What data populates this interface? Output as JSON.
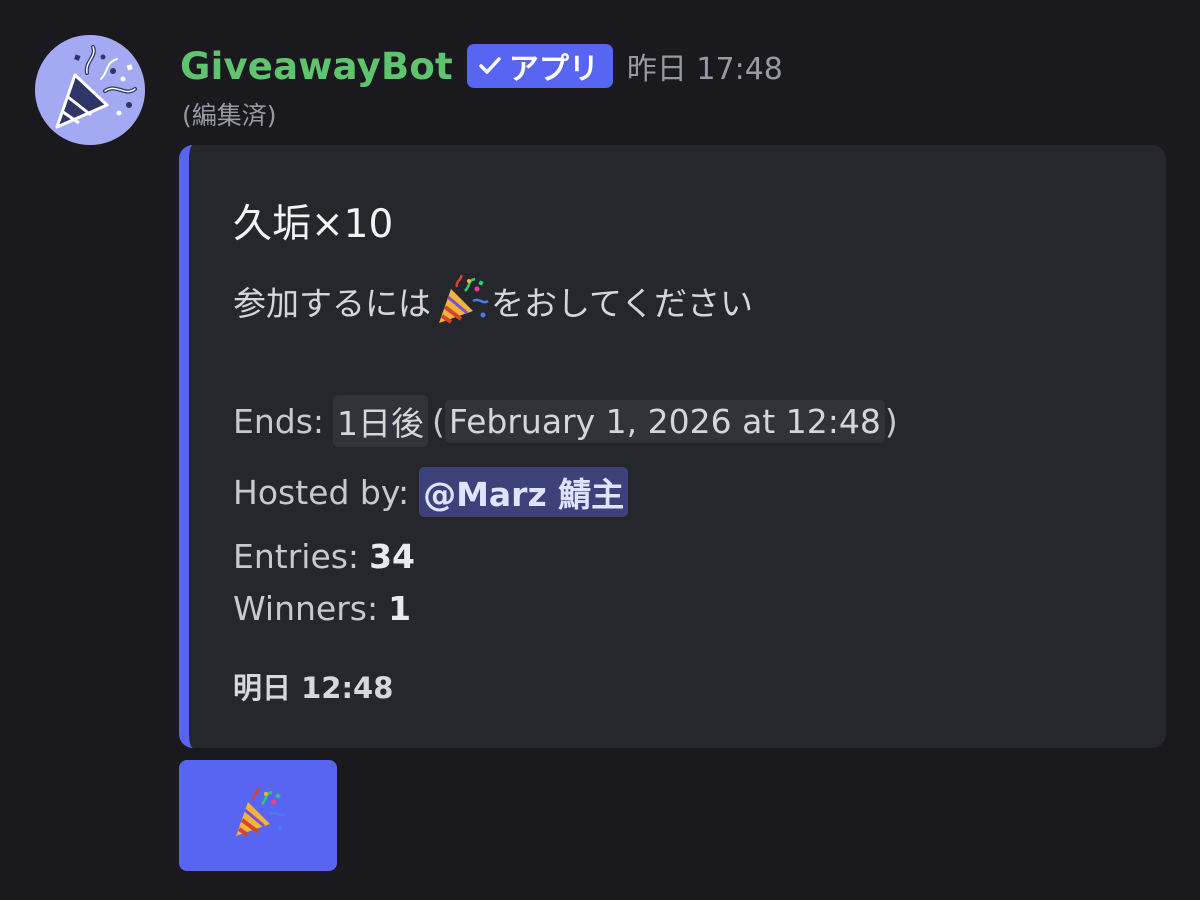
{
  "message": {
    "author": "GiveawayBot",
    "app_tag": "アプリ",
    "timestamp": "昨日 17:48",
    "edited": "(編集済)",
    "avatar_icon": "party-popper-icon"
  },
  "embed": {
    "accent_color": "#5865f2",
    "title": "久垢×10",
    "description_before": "参加するには",
    "description_after": "をおしてください",
    "ends_label": "Ends:",
    "ends_relative": "1日後",
    "ends_paren_open": "(",
    "ends_absolute": "February 1, 2026 at 12:48",
    "ends_paren_close": ")",
    "hosted_label": "Hosted by:",
    "hosted_mention": "@Marz 鯖主",
    "entries_label": "Entries:",
    "entries_value": "34",
    "winners_label": "Winners:",
    "winners_value": "1",
    "footer": "明日 12:48"
  },
  "button": {
    "icon": "party-popper-icon",
    "color": "#5865f2"
  },
  "colors": {
    "background": "#1a1a1e",
    "username": "#5fc46e",
    "app_tag": "#5865f2",
    "mention_bg": "#3c4279"
  }
}
